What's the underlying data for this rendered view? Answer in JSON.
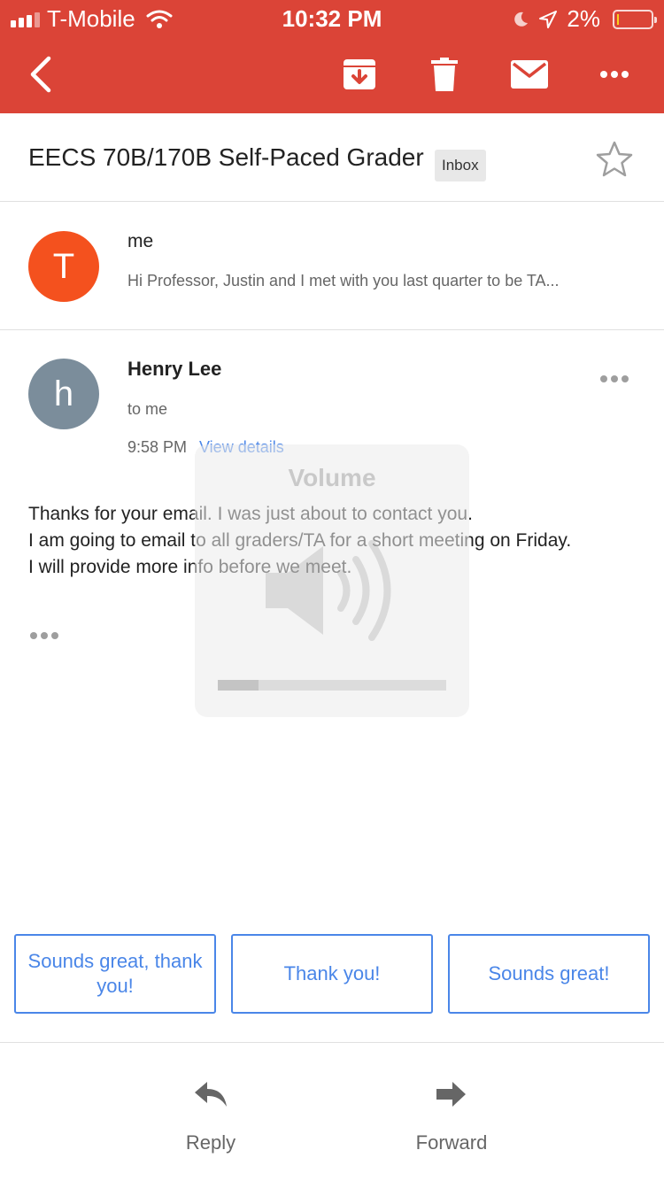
{
  "status_bar": {
    "carrier": "T-Mobile",
    "time": "10:32 PM",
    "battery": "2%"
  },
  "toolbar": {
    "icons": [
      "back-icon",
      "archive-icon",
      "delete-icon",
      "mail-icon",
      "more-icon"
    ]
  },
  "thread": {
    "subject": "EECS 70B/170B Self-Paced Grader",
    "label": "Inbox"
  },
  "messages": [
    {
      "avatar_letter": "T",
      "avatar_color": "#f4511e",
      "sender": "me",
      "snippet": "Hi Professor, Justin and I met with you last quarter to be TA..."
    },
    {
      "avatar_letter": "h",
      "avatar_color": "#7b8d9b",
      "sender": "Henry Lee",
      "to": "to me",
      "time": "9:58 PM",
      "view_details": "View details",
      "body": [
        "Thanks for your email. I was just about to contact you.",
        "I am going to email to all graders/TA for a short meeting on Friday.",
        "I will provide more info before we meet."
      ]
    }
  ],
  "volume_hud": {
    "title": "Volume",
    "level": 0.18
  },
  "smart_replies": [
    "Sounds great, thank you!",
    "Thank you!",
    "Sounds great!"
  ],
  "actions": {
    "reply": "Reply",
    "forward": "Forward"
  },
  "colors": {
    "header": "#db4437",
    "link": "#4a86e8"
  }
}
